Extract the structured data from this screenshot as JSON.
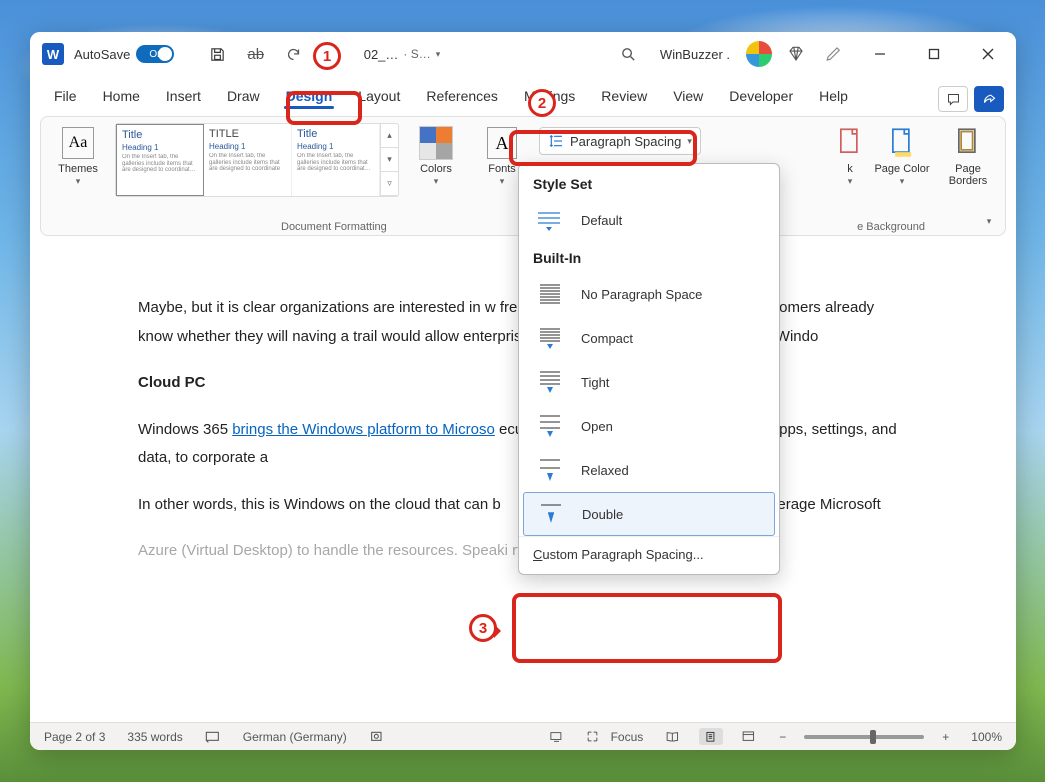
{
  "titlebar": {
    "word_letter": "W",
    "autosave_label": "AutoSave",
    "autosave_state": "On",
    "doc_name": "02_…",
    "doc_status": "· S…",
    "user_name": "WinBuzzer ."
  },
  "tabs": {
    "items": [
      "File",
      "Home",
      "Insert",
      "Draw",
      "Design",
      "Layout",
      "References",
      "Mailings",
      "Review",
      "View",
      "Developer",
      "Help"
    ],
    "active_index": 4
  },
  "ribbon": {
    "themes_label": "Themes",
    "gallery": {
      "items": [
        {
          "title": "Title",
          "heading": "Heading 1",
          "body": "On the Insert tab, the galleries include items that are designed to coordinate with the overall look of your document."
        },
        {
          "title": "TITLE",
          "heading": "Heading 1",
          "body": "On the Insert tab, the galleries include items that are designed to coordinate"
        },
        {
          "title": "Title",
          "heading": "Heading 1",
          "body": "On the Insert tab, the galleries include items that are designed to coordinate with the overall look of your document. You can"
        }
      ]
    },
    "colors_label": "Colors",
    "fonts_label": "Fonts",
    "para_spacing_label": "Paragraph Spacing",
    "watermark_label": "k",
    "page_color_label": "Page Color",
    "page_borders_label": "Page Borders",
    "group_formatting": "Document Formatting",
    "group_background": "e Background"
  },
  "dropdown": {
    "section_styleset": "Style Set",
    "default_label": "Default",
    "section_builtin": "Built-In",
    "items": [
      "No Paragraph Space",
      "Compact",
      "Tight",
      "Open",
      "Relaxed",
      "Double"
    ],
    "custom_label": "Custom Paragraph Spacing..."
  },
  "document": {
    "p1": "Maybe, but it is clear organizations are interested in w                                                       free trial is a nice touch, I guess most customers already know whether they will                                                       naving a trail would allow enterprises to see if Microsoft can deliver a full Windo",
    "h1": "Cloud PC",
    "p2_before_link": "Windows 365 ",
    "p2_link": "brings the Windows platform to Microso",
    "p2_after_link": "                                            ecure version of Windows complete with apps, settings, and data, to corporate a",
    "p3_a": "In other words, this is Windows on the cloud that can b",
    "p3_b": "ft will leverage Microsoft",
    "p4": "Azure (Virtual Desktop) to handle the resources. Speaki                                                       rts Mac, iPadOS, iOS,"
  },
  "statusbar": {
    "page": "Page 2 of 3",
    "words": "335 words",
    "lang": "German (Germany)",
    "focus": "Focus",
    "zoom": "100%"
  },
  "callouts": {
    "one": "1",
    "two": "2",
    "three": "3"
  }
}
